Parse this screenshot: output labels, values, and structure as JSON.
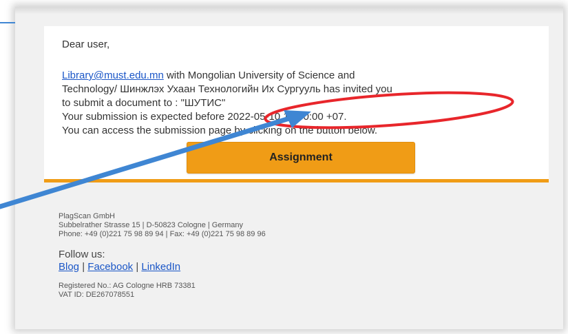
{
  "email": {
    "greeting": "Dear user,",
    "sender_link": "Library@must.edu.mn",
    "line1_rest": " with Mongolian University of Science and",
    "line2": "Technology/ Шинжлэх Ухаан Технологийн Их Сургууль has invited you",
    "line3": "to submit a document to : \"ШУТИС\"",
    "line4": "Your submission is expected before 2022-05-10 16:00:00 +07.",
    "line5": "You can access the submission page by clicking on the button below.",
    "button_label": "Assignment"
  },
  "footer": {
    "company": "PlagScan GmbH",
    "address": "Subbelrather Strasse 15 | D-50823 Cologne | Germany",
    "phone": "Phone: +49 (0)221 75 98 89 94 | Fax: +49 (0)221 75 98 89 96",
    "follow_label": "Follow us:",
    "links": [
      "Blog",
      "Facebook",
      "LinkedIn"
    ],
    "separator": "|",
    "registered": "Registered No.: AG Cologne HRB 73381",
    "vat": "VAT ID: DE267078551"
  },
  "annotations": {
    "ellipse_color": "#e8262b",
    "arrow_color": "#3f86d3"
  },
  "colors": {
    "accent": "#f09c16",
    "link": "#1a56c7"
  }
}
